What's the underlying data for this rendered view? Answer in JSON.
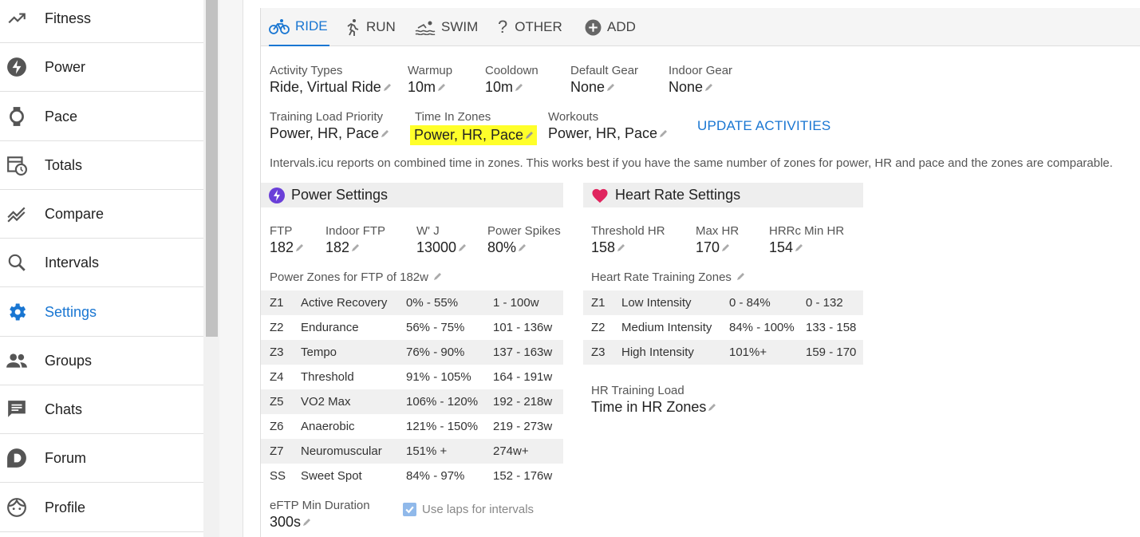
{
  "sidebar": {
    "items": [
      {
        "label": "Fitness",
        "icon": "trending-up-icon"
      },
      {
        "label": "Power",
        "icon": "bolt-icon"
      },
      {
        "label": "Pace",
        "icon": "watch-icon"
      },
      {
        "label": "Totals",
        "icon": "calendar-clock-icon"
      },
      {
        "label": "Compare",
        "icon": "compare-chart-icon"
      },
      {
        "label": "Intervals",
        "icon": "search-icon"
      },
      {
        "label": "Settings",
        "icon": "gear-icon",
        "active": true
      },
      {
        "label": "Groups",
        "icon": "people-icon"
      },
      {
        "label": "Chats",
        "icon": "chat-icon"
      },
      {
        "label": "Forum",
        "icon": "discourse-icon"
      },
      {
        "label": "Profile",
        "icon": "face-icon"
      }
    ]
  },
  "tabs": [
    {
      "label": "RIDE",
      "icon": "bike-icon",
      "active": true
    },
    {
      "label": "RUN",
      "icon": "run-icon"
    },
    {
      "label": "SWIM",
      "icon": "swim-icon"
    },
    {
      "label": "OTHER",
      "icon": "question-icon"
    },
    {
      "label": "ADD",
      "icon": "add-circle-icon"
    }
  ],
  "general": {
    "activity_types": {
      "label": "Activity Types",
      "value": "Ride, Virtual Ride"
    },
    "warmup": {
      "label": "Warmup",
      "value": "10m"
    },
    "cooldown": {
      "label": "Cooldown",
      "value": "10m"
    },
    "default_gear": {
      "label": "Default Gear",
      "value": "None"
    },
    "indoor_gear": {
      "label": "Indoor Gear",
      "value": "None"
    },
    "training_load_priority": {
      "label": "Training Load Priority",
      "value": "Power, HR, Pace"
    },
    "time_in_zones": {
      "label": "Time In Zones",
      "value": "Power, HR, Pace"
    },
    "workouts": {
      "label": "Workouts",
      "value": "Power, HR, Pace"
    },
    "update_button": "UPDATE ACTIVITIES",
    "info_text": "Intervals.icu reports on combined time in zones. This works best if you have the same number of zones for power, HR and pace and the zones are comparable."
  },
  "power": {
    "title": "Power Settings",
    "ftp": {
      "label": "FTP",
      "value": "182"
    },
    "indoor_ftp": {
      "label": "Indoor FTP",
      "value": "182"
    },
    "w_prime": {
      "label": "W' J",
      "value": "13000"
    },
    "power_spikes": {
      "label": "Power Spikes",
      "value": "80%"
    },
    "zones_title": "Power Zones for FTP of 182w",
    "zones": [
      {
        "id": "Z1",
        "name": "Active Recovery",
        "pct": "0% - 55%",
        "range": "1 - 100w"
      },
      {
        "id": "Z2",
        "name": "Endurance",
        "pct": "56% - 75%",
        "range": "101 - 136w"
      },
      {
        "id": "Z3",
        "name": "Tempo",
        "pct": "76% - 90%",
        "range": "137 - 163w"
      },
      {
        "id": "Z4",
        "name": "Threshold",
        "pct": "91% - 105%",
        "range": "164 - 191w"
      },
      {
        "id": "Z5",
        "name": "VO2 Max",
        "pct": "106% - 120%",
        "range": "192 - 218w"
      },
      {
        "id": "Z6",
        "name": "Anaerobic",
        "pct": "121% - 150%",
        "range": "219 - 273w"
      },
      {
        "id": "Z7",
        "name": "Neuromuscular",
        "pct": "151% +",
        "range": "274w+"
      },
      {
        "id": "SS",
        "name": "Sweet Spot",
        "pct": "84% - 97%",
        "range": "152 - 176w"
      }
    ],
    "eftp_min_duration": {
      "label": "eFTP Min Duration",
      "value": "300s"
    },
    "use_laps_label": "Use laps for intervals"
  },
  "hr": {
    "title": "Heart Rate Settings",
    "threshold_hr": {
      "label": "Threshold HR",
      "value": "158"
    },
    "max_hr": {
      "label": "Max HR",
      "value": "170"
    },
    "hrrc_min_hr": {
      "label": "HRRc Min HR",
      "value": "154"
    },
    "zones_title": "Heart Rate Training Zones",
    "zones": [
      {
        "id": "Z1",
        "name": "Low Intensity",
        "pct": "0 - 84%",
        "range": "0 - 132"
      },
      {
        "id": "Z2",
        "name": "Medium Intensity",
        "pct": "84% - 100%",
        "range": "133 - 158"
      },
      {
        "id": "Z3",
        "name": "High Intensity",
        "pct": "101%+",
        "range": "159 - 170"
      }
    ],
    "training_load": {
      "label": "HR Training Load",
      "value": "Time in HR Zones"
    }
  },
  "colors": {
    "accent": "#1976d2",
    "highlight": "#ffff2a",
    "power_icon": "#6a3fd8",
    "heart_icon": "#e0245e"
  }
}
